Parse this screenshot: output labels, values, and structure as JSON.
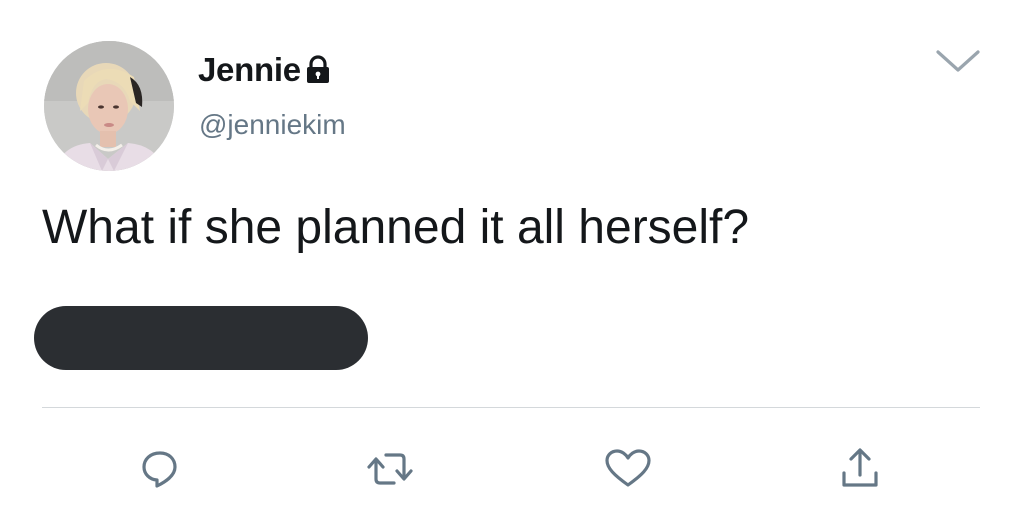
{
  "tweet": {
    "display_name": "Jennie",
    "handle": "@jenniekim",
    "protected_icon": "lock-icon",
    "text": "What if she planned it all herself?",
    "menu_icon": "chevron-down-icon",
    "redacted": true
  },
  "actions": [
    {
      "name": "reply",
      "icon": "reply-icon"
    },
    {
      "name": "retweet",
      "icon": "retweet-icon"
    },
    {
      "name": "like",
      "icon": "heart-icon"
    },
    {
      "name": "share",
      "icon": "share-icon"
    }
  ],
  "colors": {
    "text": "#14171a",
    "secondary_text": "#657786",
    "icon": "#657786",
    "divider": "#d4d8db",
    "redaction": "#2b2e32"
  }
}
